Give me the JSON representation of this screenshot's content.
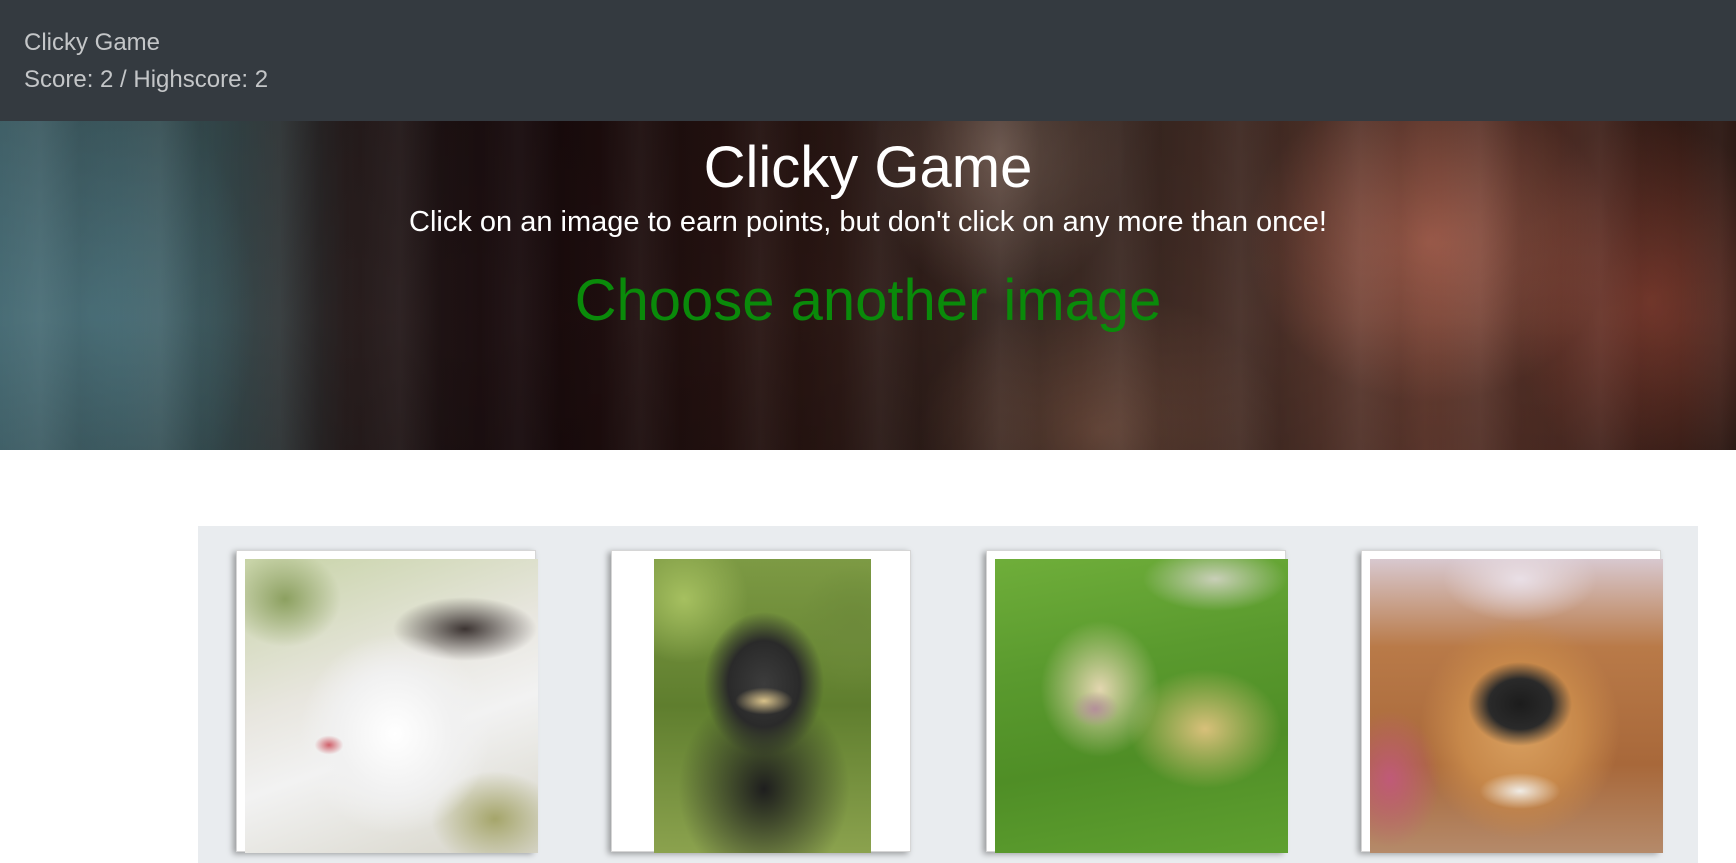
{
  "navbar": {
    "brand": "Clicky Game",
    "score_text": "Score: 2 / Highscore: 2",
    "score": 2,
    "highscore": 2
  },
  "hero": {
    "title": "Clicky Game",
    "subtitle": "Click on an image to earn points, but don't click on any more than once!",
    "message": "Choose another image",
    "message_color": "#0a8a0a"
  },
  "colors": {
    "navbar_bg": "#343a40",
    "board_bg": "#e9ecef"
  },
  "cards": [
    {
      "subject": "cat",
      "alt": "cat"
    },
    {
      "subject": "monkey",
      "alt": "monkey"
    },
    {
      "subject": "cow",
      "alt": "cow"
    },
    {
      "subject": "dog",
      "alt": "dog"
    }
  ]
}
